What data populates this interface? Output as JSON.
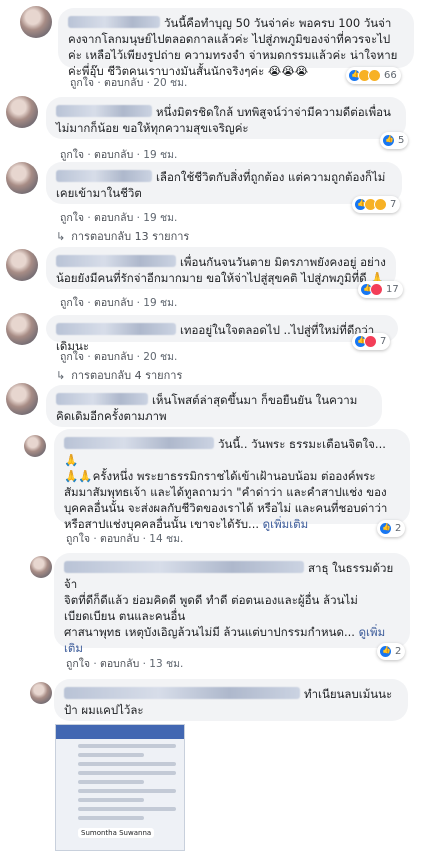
{
  "meta_labels": {
    "like": "ถูกใจ",
    "reply": "ตอบกลับ"
  },
  "comments": [
    {
      "text": "วันนี้คือทำบุญ 50 วันจ่าค่ะ พอครบ 100 วันจ่าคงจากโลกมนุษย์ไปตลอดกาลแล้วค่ะ ไปสู่ภพภูมิของจ่าที่ควรจะไปค่ะ เหลือไว้เพียงรูปถ่าย ความทรงจำ จ่าหมดกรรมแล้วค่ะ น่าใจหายค่ะพี่อุ๊บ ชีวิตคนเราบางมันสั้นนักจริงๆค่ะ 😭😭😭",
      "time": "20 ชม.",
      "react_count": "66"
    },
    {
      "text": "หนึ่งมิตรชิดใกล้ บทพิสูจน์ว่าจ่ามีความดีต่อเพื่อนไม่มากก็น้อย ขอให้ทุกความสุขเจริญค่ะ",
      "time": "19 ชม.",
      "react_count": "5"
    },
    {
      "text": "เลือกใช้ชีวิตกับสิ่งที่ถูกต้อง แต่ความถูกต้องก็ไม่เคยเข้ามาในชีวิต",
      "time": "19 ชม.",
      "react_count": "7",
      "replies": "การตอบกลับ 13 รายการ"
    },
    {
      "text": "เพื่อนกันจนวันตาย มิตรภาพยังคงอยู่ อย่างน้อยยังมีคนที่รักจ่าอีกมากมาย ขอให้จ่าไปสู่สุขคติ ไปสู่ภพภูมิที่ดี 🙏",
      "time": "19 ชม.",
      "react_count": "17"
    },
    {
      "text": "เทออยู่ในใจตลอดไป ..ไปสู่ที่ใหม่ที่ดีกว่าเดิมนะ",
      "time": "20 ชม.",
      "react_count": "7",
      "replies": "การตอบกลับ 4 รายการ"
    },
    {
      "text": "เห็นโพสต์ล่าสุดขึ้นมา ก็ขอยืนยัน ในความคิดเดิมอีกครั้งตามภาพ"
    },
    {
      "text": "วันนี้.. วันพระ ธรรมะเตือนจิตใจ...🙏\n🙏🙏ครั้งหนึ่ง พระยาธรรมิกราชได้เข้าเฝ้านอบน้อม ต่อองค์พระสัมมาสัมพุทธเจ้า และได้ทูลถามว่า \"คำด่าว่า และคำสาปแช่ง ของบุคคลอื่นนั้น จะส่งผลกับชีวิตของเราได้ หรือไม่ และคนที่ชอบด่าว่า หรือสาปแช่งบุคคลอื่นนั้น เขาจะได้รับ...",
      "more": "ดูเพิ่มเติม",
      "time": "14 ชม.",
      "react_count": "2"
    },
    {
      "text": "สาธุ ในธรรมด้วยจ้า\nจิตที่ดีก็ดีแล้ว ย่อมคิดดี พูดดี ทำดี ต่อตนเองและผู้อื่น ล้วนไม่เบียดเบียน ตนและคนอื่น\nศาสนาพุทธ เหตุบังเอิญล้วนไม่มี ล้วนแต่บาปกรรมกำหนด...",
      "more": "ดูเพิ่มเติม",
      "time": "13 ชม.",
      "react_count": "2"
    },
    {
      "text": "ทำเนียนลบเม้นนะป้า ผมแคปไว้ละ"
    }
  ],
  "embedded_screenshot": {
    "caption": "Sumontha Suwanna"
  },
  "colors": {
    "bubble": "#f2f3f5",
    "link": "#385898",
    "like_blue": "#1877f2",
    "meta": "#606770"
  },
  "icons": [
    "like-reaction-icon",
    "sad-reaction-icon",
    "love-reaction-icon",
    "reply-arrow-icon"
  ]
}
